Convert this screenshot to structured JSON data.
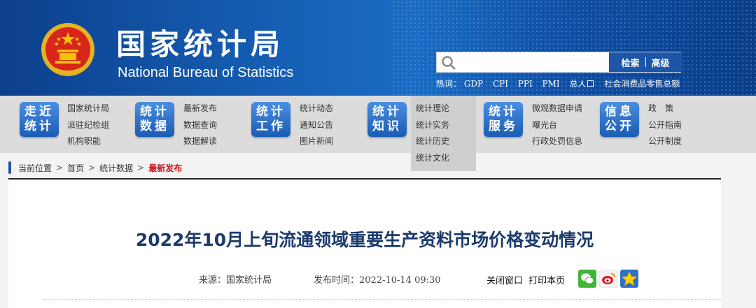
{
  "header": {
    "title_cn": "国家统计局",
    "title_en": "National Bureau of Statistics",
    "emblem_icon": "national-emblem-icon",
    "search": {
      "placeholder": "",
      "search_label": "检索",
      "advanced_label": "高级"
    },
    "hot_label": "热词：",
    "hot_words": [
      "GDP",
      "CPI",
      "PPI",
      "PMI",
      "总人口",
      "社会消费品零售总额"
    ]
  },
  "nav": [
    {
      "badge": "走近统计",
      "links": [
        "国家统计局",
        "派驻纪检组",
        "机构职能"
      ]
    },
    {
      "badge": "统计数据",
      "links": [
        "最新发布",
        "数据查询",
        "数据解读"
      ]
    },
    {
      "badge": "统计工作",
      "links": [
        "统计动态",
        "通知公告",
        "图片新闻"
      ]
    },
    {
      "badge": "统计知识",
      "links": [
        "统计理论",
        "统计实务",
        "统计历史",
        "统计文化"
      ]
    },
    {
      "badge": "统计服务",
      "links": [
        "微观数据申请",
        "曝光台",
        "行政处罚信息"
      ]
    },
    {
      "badge": "信息公开",
      "links": [
        "政　策",
        "公开指南",
        "公开制度"
      ]
    }
  ],
  "breadcrumb": {
    "label": "当前位置",
    "items": [
      "首页",
      "统计数据"
    ],
    "current": "最新发布"
  },
  "article": {
    "title": "2022年10月上旬流通领域重要生产资料市场价格变动情况",
    "source": "来源：国家统计局",
    "published": "发布时间：2022-10-14 09:30",
    "close_label": "关闭窗口",
    "print_label": "打印本页",
    "share_icons": [
      "wechat-icon",
      "weibo-icon",
      "favorite-star-icon"
    ]
  },
  "colors": {
    "brand_blue": "#1d56a8",
    "title_blue": "#1c3a6c",
    "current_red": "#c8141b"
  }
}
